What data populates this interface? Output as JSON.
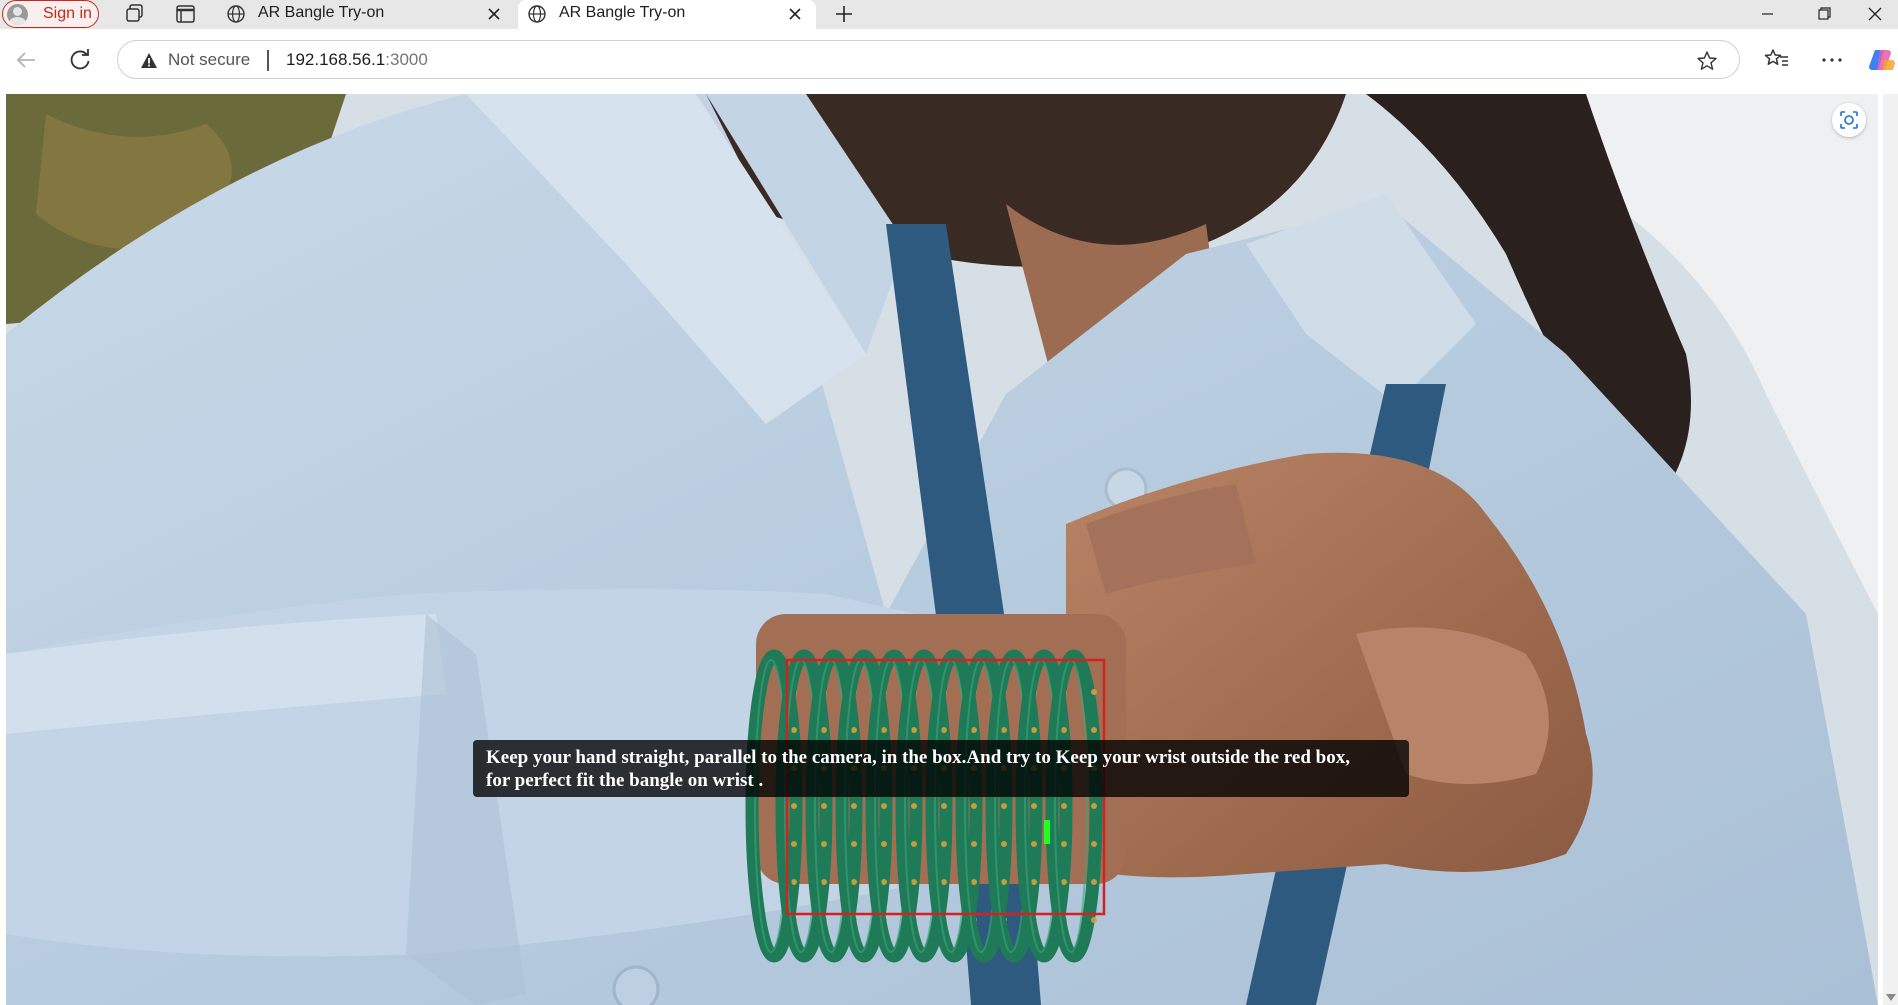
{
  "browser": {
    "profile_label": "Sign in",
    "tabs": [
      {
        "title": "AR Bangle Try-on",
        "active": false
      },
      {
        "title": "AR Bangle Try-on",
        "active": true
      }
    ],
    "security_label": "Not secure",
    "url_host": "192.168.56.1",
    "url_port": ":3000"
  },
  "page": {
    "instruction_line1": "Keep your hand straight, parallel to the camera, in the box.And try to Keep your wrist outside the red box,",
    "instruction_line2": "for perfect fit the bangle on wrist ."
  },
  "icons": {
    "profile": "profile-avatar-icon",
    "workspaces": "workspaces-icon",
    "tab_actions": "tab-actions-icon",
    "favicon": "globe-icon",
    "close_tab": "close-icon",
    "new_tab": "plus-icon",
    "minimize": "minimize-icon",
    "restore": "restore-icon",
    "close_window": "close-icon",
    "back": "back-arrow-icon",
    "refresh": "refresh-icon",
    "warning": "warning-icon",
    "favorite": "star-icon",
    "favorites": "favorites-icon",
    "more": "more-icon",
    "copilot": "copilot-icon",
    "screenshot": "visual-search-icon"
  },
  "colors": {
    "guide_box": "#d42020",
    "bangle": "#1f7a57",
    "marker": "#22ff22",
    "security_warning": "#c42b1c"
  }
}
